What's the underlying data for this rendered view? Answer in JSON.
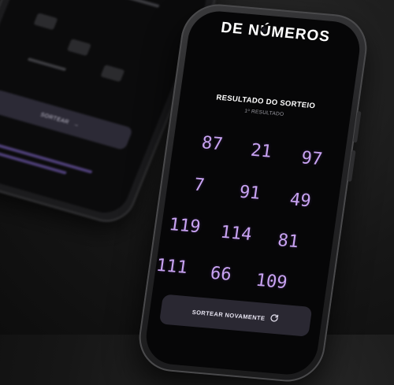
{
  "back_phone": {
    "draw_button_label": "SORTEAR",
    "arrow": "→"
  },
  "front_phone": {
    "header_title": "DE NÚMEROS",
    "result_title": "RESULTADO DO SORTEIO",
    "result_subtitle": "1º RESULTADO",
    "numbers": [
      "87",
      "21",
      "97",
      "7",
      "91",
      "49",
      "119",
      "114",
      "81",
      "111",
      "66",
      "109"
    ],
    "redraw_label": "SORTEAR NOVAMENTE",
    "redraw_icon": "refresh-icon"
  },
  "colors": {
    "accent_number": "#c8a2f2",
    "screen_background": "#060607",
    "button_background": "#2a2832"
  }
}
